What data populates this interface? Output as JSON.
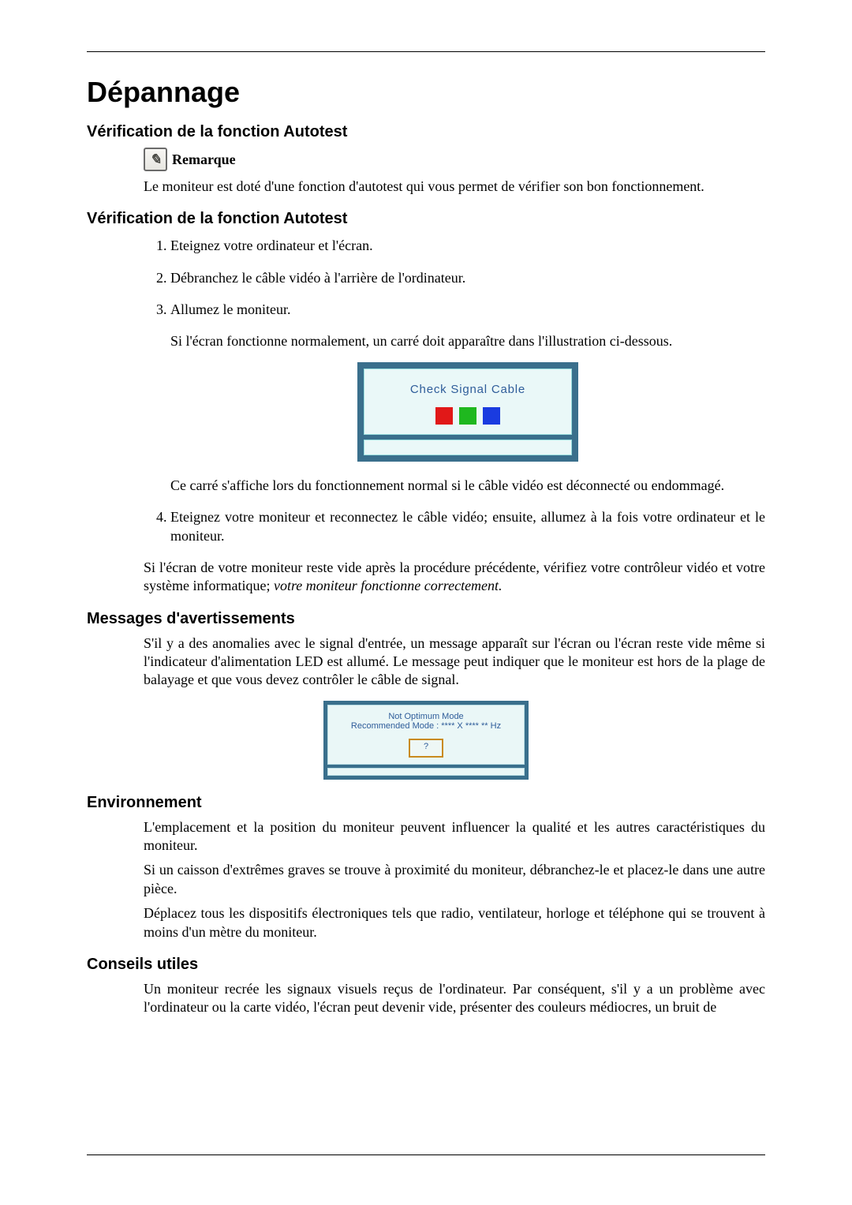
{
  "title": "Dépannage",
  "section1": {
    "heading": "Vérification de la fonction Autotest",
    "note_label": "Remarque",
    "note_body": "Le moniteur est doté d'une fonction d'autotest qui vous permet de vérifier son bon fonctionnement."
  },
  "section2": {
    "heading": "Vérification de la fonction Autotest",
    "step1": "Eteignez votre ordinateur et l'écran.",
    "step2": "Débranchez le câble vidéo à l'arrière de l'ordinateur.",
    "step3": "Allumez le moniteur.",
    "step3_sub": "Si l'écran fonctionne normalement, un carré doit apparaître dans l'illustration ci-dessous.",
    "figure1_caption": "Check Signal Cable",
    "step3_sub2": "Ce carré s'affiche lors du fonctionnement normal si le câble vidéo est déconnecté ou endommagé.",
    "step4": "Eteignez votre moniteur et reconnectez le câble vidéo; ensuite, allumez à la fois votre ordinateur et le moniteur.",
    "tail_plain": "Si l'écran de votre moniteur reste vide après la procédure précédente, vérifiez votre contrôleur vidéo et votre système informatique; ",
    "tail_italic": "votre moniteur fonctionne correctement."
  },
  "section3": {
    "heading": "Messages d'avertissements",
    "p1": "S'il y a des anomalies avec le signal d'entrée, un message apparaît sur l'écran ou l'écran reste vide même si l'indicateur d'alimentation LED est allumé. Le message peut indiquer que le moniteur est hors de la plage de balayage et que vous devez contrôler le câble de signal.",
    "fig_line1": "Not Optimum Mode",
    "fig_line2": "Recommended Mode : **** X **** ** Hz",
    "fig_btn": "?"
  },
  "section4": {
    "heading": "Environnement",
    "p1": "L'emplacement et la position du moniteur peuvent influencer la qualité et les autres caractéristiques du moniteur.",
    "p2": "Si un caisson d'extrêmes graves se trouve à proximité du moniteur, débranchez-le et placez-le dans une autre pièce.",
    "p3": "Déplacez tous les dispositifs électroniques tels que radio, ventilateur, horloge et téléphone qui se trouvent à moins d'un mètre du moniteur."
  },
  "section5": {
    "heading": "Conseils utiles",
    "p1": "Un moniteur recrée les signaux visuels reçus de l'ordinateur. Par conséquent, s'il y a un problème avec l'ordinateur ou la carte vidéo, l'écran peut devenir vide, présenter des couleurs médiocres, un bruit de"
  }
}
